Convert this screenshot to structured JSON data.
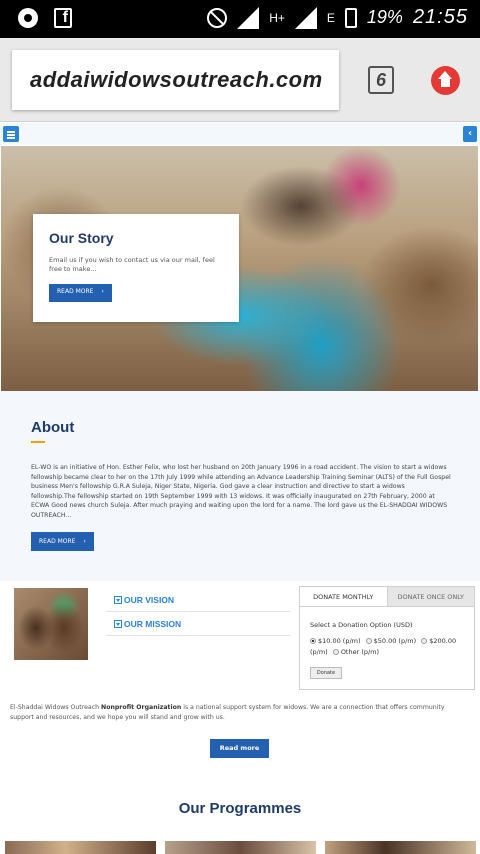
{
  "status_bar": {
    "network_letter": "H+",
    "network_letter2": "E",
    "battery": "19%",
    "time": "21:55"
  },
  "browser": {
    "url": "addaiwidowsoutreach.com",
    "tab_count": "6"
  },
  "hero": {
    "title": "Our Story",
    "text": "Email us if you wish to contact us via our mail, feel free to make...",
    "button": "READ MORE"
  },
  "about": {
    "title": "About",
    "text": "EL-WO is an initiative of Hon. Esther Felix, who lost her husband on 20th January 1996 in a road accident. The vision to start a widows fellowship became clear to her on the 17th July 1999 while attending an Advance Leadership Training Seminar (ALTS) of the Full Gospel business Men's fellowship G.R.A Suleja, Niger State, Nigeria.  God gave a clear instruction and directive to start a widows fellowship.The fellowship started on 19th September 1999 with 13 widows. It was officially inaugurated on 27th February, 2000 at ECWA Good news church Suleja. After much praying and waiting upon the lord for a name. The lord gave us the EL-SHADDAI WIDOWS OUTREACH...",
    "button": "READ MORE"
  },
  "accordion": {
    "vision": "OUR VISION",
    "mission": "OUR MISSION"
  },
  "donate": {
    "tab_monthly": "DONATE MONTHLY",
    "tab_once": "DONATE ONCE ONLY",
    "label": "Select a Donation Option (USD)",
    "opt1": "$10.00 (p/m)",
    "opt2": "$50.00 (p/m)",
    "opt3": "$200.00",
    "opt3_unit": "(p/m)",
    "opt4": "Other (p/m)",
    "button": "Donate"
  },
  "org": {
    "name": "El-Shaddai Widows Outreach",
    "type": "Nonprofit Organization",
    "text": "is a national support system for widows. We are a connection that offers community support and resources, and we hope you will stand and grow with us.",
    "button": "Read more"
  },
  "programmes": {
    "title": "Our Programmes"
  }
}
